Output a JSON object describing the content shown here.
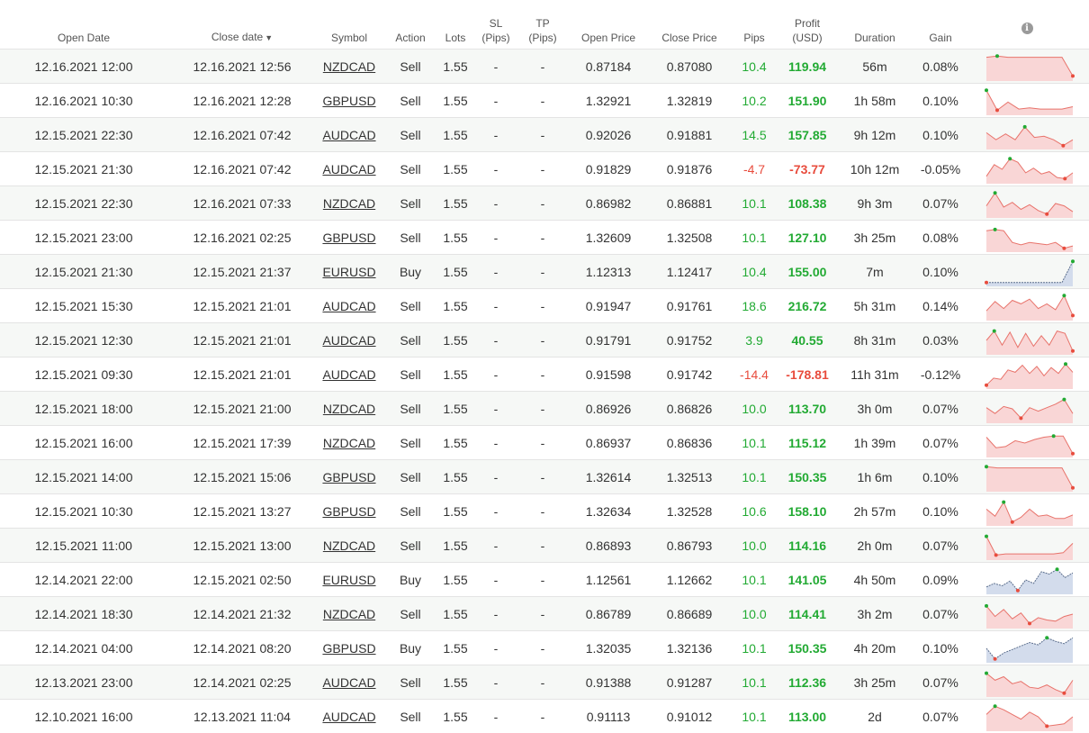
{
  "headers": {
    "open_date": "Open Date",
    "close_date": "Close date",
    "sort_glyph": "▼",
    "symbol": "Symbol",
    "action": "Action",
    "lots": "Lots",
    "sl_line1": "SL",
    "sl_line2": "(Pips)",
    "tp_line1": "TP",
    "tp_line2": "(Pips)",
    "open_price": "Open Price",
    "close_price": "Close Price",
    "pips": "Pips",
    "profit_line1": "Profit",
    "profit_line2": "(USD)",
    "duration": "Duration",
    "gain": "Gain",
    "info_glyph": "i"
  },
  "colors": {
    "positive": "#22aa33",
    "negative": "#e84c3d",
    "sell_fill": "#f9d6d6",
    "sell_line": "#e8736b",
    "buy_fill": "#d3dcec",
    "buy_line": "#5a6d8c"
  },
  "rows": [
    {
      "open": "12.16.2021 12:00",
      "close": "12.16.2021 12:56",
      "symbol": "NZDCAD",
      "action": "Sell",
      "lots": "1.55",
      "sl": "-",
      "tp": "-",
      "open_price": "0.87184",
      "close_price": "0.87080",
      "pips": "10.4",
      "profit": "119.94",
      "duration": "56m",
      "gain": "0.08%",
      "positive": true,
      "spark": [
        0.9,
        0.95,
        0.9,
        0.9,
        0.9,
        0.9,
        0.9,
        0.9,
        0.1
      ]
    },
    {
      "open": "12.16.2021 10:30",
      "close": "12.16.2021 12:28",
      "symbol": "GBPUSD",
      "action": "Sell",
      "lots": "1.55",
      "sl": "-",
      "tp": "-",
      "open_price": "1.32921",
      "close_price": "1.32819",
      "pips": "10.2",
      "profit": "151.90",
      "duration": "1h 58m",
      "gain": "0.10%",
      "positive": true,
      "spark": [
        0.95,
        0.1,
        0.45,
        0.15,
        0.2,
        0.15,
        0.15,
        0.15,
        0.25
      ]
    },
    {
      "open": "12.15.2021 22:30",
      "close": "12.16.2021 07:42",
      "symbol": "AUDCAD",
      "action": "Sell",
      "lots": "1.55",
      "sl": "-",
      "tp": "-",
      "open_price": "0.92026",
      "close_price": "0.91881",
      "pips": "14.5",
      "profit": "157.85",
      "duration": "9h 12m",
      "gain": "0.10%",
      "positive": true,
      "spark": [
        0.6,
        0.3,
        0.55,
        0.3,
        0.85,
        0.4,
        0.45,
        0.3,
        0.05,
        0.3
      ]
    },
    {
      "open": "12.15.2021 21:30",
      "close": "12.16.2021 07:42",
      "symbol": "AUDCAD",
      "action": "Sell",
      "lots": "1.55",
      "sl": "-",
      "tp": "-",
      "open_price": "0.91829",
      "close_price": "0.91876",
      "pips": "-4.7",
      "profit": "-73.77",
      "duration": "10h 12m",
      "gain": "-0.05%",
      "positive": false,
      "spark": [
        0.2,
        0.7,
        0.5,
        0.95,
        0.8,
        0.35,
        0.55,
        0.3,
        0.4,
        0.15,
        0.1,
        0.35
      ]
    },
    {
      "open": "12.15.2021 22:30",
      "close": "12.16.2021 07:33",
      "symbol": "NZDCAD",
      "action": "Sell",
      "lots": "1.55",
      "sl": "-",
      "tp": "-",
      "open_price": "0.86982",
      "close_price": "0.86881",
      "pips": "10.1",
      "profit": "108.38",
      "duration": "9h 3m",
      "gain": "0.07%",
      "positive": true,
      "spark": [
        0.4,
        0.95,
        0.35,
        0.55,
        0.25,
        0.45,
        0.2,
        0.05,
        0.5,
        0.4,
        0.15
      ]
    },
    {
      "open": "12.15.2021 23:00",
      "close": "12.16.2021 02:25",
      "symbol": "GBPUSD",
      "action": "Sell",
      "lots": "1.55",
      "sl": "-",
      "tp": "-",
      "open_price": "1.32609",
      "close_price": "1.32508",
      "pips": "10.1",
      "profit": "127.10",
      "duration": "3h 25m",
      "gain": "0.08%",
      "positive": true,
      "spark": [
        0.8,
        0.85,
        0.8,
        0.3,
        0.2,
        0.3,
        0.25,
        0.2,
        0.3,
        0.05,
        0.15
      ]
    },
    {
      "open": "12.15.2021 21:30",
      "close": "12.15.2021 21:37",
      "symbol": "EURUSD",
      "action": "Buy",
      "lots": "1.55",
      "sl": "-",
      "tp": "-",
      "open_price": "1.12313",
      "close_price": "1.12417",
      "pips": "10.4",
      "profit": "155.00",
      "duration": "7m",
      "gain": "0.10%",
      "positive": true,
      "spark": [
        0.05,
        0.05,
        0.05,
        0.05,
        0.05,
        0.05,
        0.05,
        0.05,
        0.95
      ]
    },
    {
      "open": "12.15.2021 15:30",
      "close": "12.15.2021 21:01",
      "symbol": "AUDCAD",
      "action": "Sell",
      "lots": "1.55",
      "sl": "-",
      "tp": "-",
      "open_price": "0.91947",
      "close_price": "0.91761",
      "pips": "18.6",
      "profit": "216.72",
      "duration": "5h 31m",
      "gain": "0.14%",
      "positive": true,
      "spark": [
        0.3,
        0.7,
        0.4,
        0.75,
        0.6,
        0.8,
        0.4,
        0.6,
        0.35,
        0.95,
        0.1
      ]
    },
    {
      "open": "12.15.2021 12:30",
      "close": "12.15.2021 21:01",
      "symbol": "AUDCAD",
      "action": "Sell",
      "lots": "1.55",
      "sl": "-",
      "tp": "-",
      "open_price": "0.91791",
      "close_price": "0.91752",
      "pips": "3.9",
      "profit": "40.55",
      "duration": "8h 31m",
      "gain": "0.03%",
      "positive": true,
      "spark": [
        0.5,
        0.9,
        0.3,
        0.85,
        0.2,
        0.8,
        0.25,
        0.7,
        0.3,
        0.9,
        0.8,
        0.05
      ]
    },
    {
      "open": "12.15.2021 09:30",
      "close": "12.15.2021 21:01",
      "symbol": "AUDCAD",
      "action": "Sell",
      "lots": "1.55",
      "sl": "-",
      "tp": "-",
      "open_price": "0.91598",
      "close_price": "0.91742",
      "pips": "-14.4",
      "profit": "-178.81",
      "duration": "11h 31m",
      "gain": "-0.12%",
      "positive": false,
      "spark": [
        0.05,
        0.35,
        0.3,
        0.7,
        0.6,
        0.9,
        0.55,
        0.85,
        0.45,
        0.8,
        0.55,
        0.95,
        0.6
      ]
    },
    {
      "open": "12.15.2021 18:00",
      "close": "12.15.2021 21:00",
      "symbol": "NZDCAD",
      "action": "Sell",
      "lots": "1.55",
      "sl": "-",
      "tp": "-",
      "open_price": "0.86926",
      "close_price": "0.86826",
      "pips": "10.0",
      "profit": "113.70",
      "duration": "3h 0m",
      "gain": "0.07%",
      "positive": true,
      "spark": [
        0.55,
        0.3,
        0.6,
        0.5,
        0.1,
        0.55,
        0.4,
        0.55,
        0.7,
        0.9,
        0.3
      ]
    },
    {
      "open": "12.15.2021 16:00",
      "close": "12.15.2021 17:39",
      "symbol": "NZDCAD",
      "action": "Sell",
      "lots": "1.55",
      "sl": "-",
      "tp": "-",
      "open_price": "0.86937",
      "close_price": "0.86836",
      "pips": "10.1",
      "profit": "115.12",
      "duration": "1h 39m",
      "gain": "0.07%",
      "positive": true,
      "spark": [
        0.75,
        0.3,
        0.35,
        0.6,
        0.5,
        0.65,
        0.75,
        0.8,
        0.8,
        0.05
      ]
    },
    {
      "open": "12.15.2021 14:00",
      "close": "12.15.2021 15:06",
      "symbol": "GBPUSD",
      "action": "Sell",
      "lots": "1.55",
      "sl": "-",
      "tp": "-",
      "open_price": "1.32614",
      "close_price": "1.32513",
      "pips": "10.1",
      "profit": "150.35",
      "duration": "1h 6m",
      "gain": "0.10%",
      "positive": true,
      "spark": [
        0.95,
        0.9,
        0.9,
        0.9,
        0.9,
        0.9,
        0.9,
        0.9,
        0.05
      ]
    },
    {
      "open": "12.15.2021 10:30",
      "close": "12.15.2021 13:27",
      "symbol": "GBPUSD",
      "action": "Sell",
      "lots": "1.55",
      "sl": "-",
      "tp": "-",
      "open_price": "1.32634",
      "close_price": "1.32528",
      "pips": "10.6",
      "profit": "158.10",
      "duration": "2h 57m",
      "gain": "0.10%",
      "positive": true,
      "spark": [
        0.6,
        0.3,
        0.9,
        0.05,
        0.25,
        0.6,
        0.3,
        0.35,
        0.2,
        0.2,
        0.35
      ]
    },
    {
      "open": "12.15.2021 11:00",
      "close": "12.15.2021 13:00",
      "symbol": "NZDCAD",
      "action": "Sell",
      "lots": "1.55",
      "sl": "-",
      "tp": "-",
      "open_price": "0.86893",
      "close_price": "0.86793",
      "pips": "10.0",
      "profit": "114.16",
      "duration": "2h 0m",
      "gain": "0.07%",
      "positive": true,
      "spark": [
        0.9,
        0.1,
        0.15,
        0.15,
        0.15,
        0.15,
        0.15,
        0.15,
        0.2,
        0.6
      ]
    },
    {
      "open": "12.14.2021 22:00",
      "close": "12.15.2021 02:50",
      "symbol": "EURUSD",
      "action": "Buy",
      "lots": "1.55",
      "sl": "-",
      "tp": "-",
      "open_price": "1.12561",
      "close_price": "1.12662",
      "pips": "10.1",
      "profit": "141.05",
      "duration": "4h 50m",
      "gain": "0.09%",
      "positive": true,
      "spark": [
        0.2,
        0.35,
        0.25,
        0.45,
        0.05,
        0.5,
        0.35,
        0.85,
        0.75,
        0.95,
        0.6,
        0.8
      ]
    },
    {
      "open": "12.14.2021 18:30",
      "close": "12.14.2021 21:32",
      "symbol": "NZDCAD",
      "action": "Sell",
      "lots": "1.55",
      "sl": "-",
      "tp": "-",
      "open_price": "0.86789",
      "close_price": "0.86689",
      "pips": "10.0",
      "profit": "114.41",
      "duration": "3h 2m",
      "gain": "0.07%",
      "positive": true,
      "spark": [
        0.85,
        0.4,
        0.7,
        0.3,
        0.55,
        0.1,
        0.35,
        0.25,
        0.2,
        0.4,
        0.5
      ]
    },
    {
      "open": "12.14.2021 04:00",
      "close": "12.14.2021 08:20",
      "symbol": "GBPUSD",
      "action": "Buy",
      "lots": "1.55",
      "sl": "-",
      "tp": "-",
      "open_price": "1.32035",
      "close_price": "1.32136",
      "pips": "10.1",
      "profit": "150.35",
      "duration": "4h 20m",
      "gain": "0.10%",
      "positive": true,
      "spark": [
        0.5,
        0.05,
        0.3,
        0.45,
        0.6,
        0.75,
        0.65,
        0.95,
        0.8,
        0.7,
        0.95
      ]
    },
    {
      "open": "12.13.2021 23:00",
      "close": "12.14.2021 02:25",
      "symbol": "AUDCAD",
      "action": "Sell",
      "lots": "1.55",
      "sl": "-",
      "tp": "-",
      "open_price": "0.91388",
      "close_price": "0.91287",
      "pips": "10.1",
      "profit": "112.36",
      "duration": "3h 25m",
      "gain": "0.07%",
      "positive": true,
      "spark": [
        0.9,
        0.6,
        0.75,
        0.45,
        0.55,
        0.3,
        0.25,
        0.4,
        0.2,
        0.05,
        0.6
      ]
    },
    {
      "open": "12.10.2021 16:00",
      "close": "12.13.2021 11:04",
      "symbol": "AUDCAD",
      "action": "Sell",
      "lots": "1.55",
      "sl": "-",
      "tp": "-",
      "open_price": "0.91113",
      "close_price": "0.91012",
      "pips": "10.1",
      "profit": "113.00",
      "duration": "2d",
      "gain": "0.07%",
      "positive": true,
      "spark": [
        0.6,
        0.95,
        0.8,
        0.6,
        0.4,
        0.7,
        0.5,
        0.1,
        0.15,
        0.2,
        0.5
      ]
    }
  ]
}
